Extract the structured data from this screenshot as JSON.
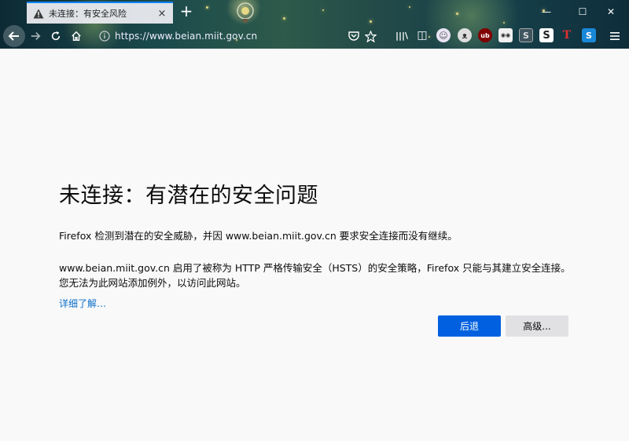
{
  "tab": {
    "title": "未连接：有安全风险",
    "close": "×"
  },
  "new_tab": "+",
  "window": {
    "minimize": "—",
    "maximize": "☐",
    "close": "✕"
  },
  "urlbar": {
    "url": "https://www.beian.miit.gov.cn"
  },
  "toolbar_extensions": [
    {
      "name": "library-icon",
      "label": "|||\\"
    },
    {
      "name": "reader-sidebar-icon",
      "label": "◫"
    },
    {
      "name": "ghost-extension-icon",
      "label": "☺"
    },
    {
      "name": "cat-extension-icon",
      "label": "ᴥ"
    },
    {
      "name": "ublock-icon",
      "label": "ub"
    },
    {
      "name": "tracker-extension-icon",
      "label": "◉◉"
    },
    {
      "name": "s-extension-icon",
      "label": "S"
    },
    {
      "name": "stylus-icon",
      "label": "S"
    },
    {
      "name": "t-extension-icon",
      "label": "T"
    },
    {
      "name": "s-blue-extension-icon",
      "label": "S"
    }
  ],
  "error": {
    "title": "未连接：有潜在的安全问题",
    "para1": "Firefox 检测到潜在的安全威胁，并因 www.beian.miit.gov.cn 要求安全连接而没有继续。",
    "para2_line1": "www.beian.miit.gov.cn 启用了被称为 HTTP 严格传输安全（HSTS）的安全策略，Firefox 只能与其建立安全连接。",
    "para2_line2": "您无法为此网站添加例外，以访问此网站。",
    "learn_more": "详细了解…",
    "back_button": "后退",
    "advanced_button": "高级..."
  },
  "colors": {
    "accent": "#0060df",
    "link": "#0a6ec8",
    "page_bg": "#f9f9fa"
  }
}
